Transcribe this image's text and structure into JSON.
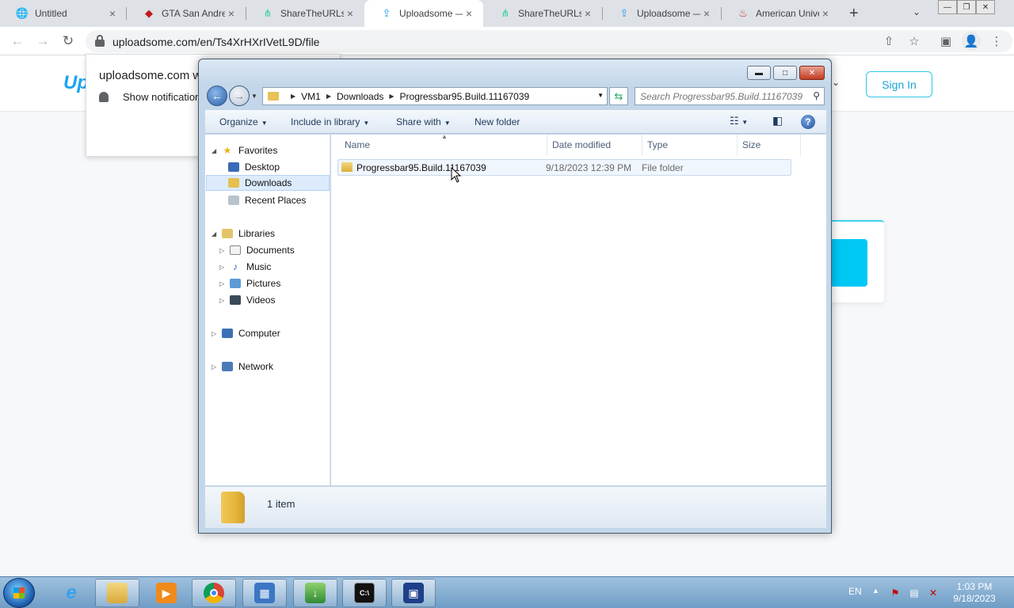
{
  "browser": {
    "tabs": [
      {
        "title": "Untitled",
        "icon": "globe-icon"
      },
      {
        "title": "GTA San Andrea",
        "icon": "gamepad-icon"
      },
      {
        "title": "ShareTheURLs",
        "icon": "share-icon"
      },
      {
        "title": "Uploadsome —",
        "icon": "upload-icon",
        "active": true
      },
      {
        "title": "ShareTheURLs",
        "icon": "share-icon"
      },
      {
        "title": "Uploadsome —",
        "icon": "upload-icon"
      },
      {
        "title": "American Unive",
        "icon": "flame-icon"
      }
    ],
    "url": "uploadsome.com/en/Ts4XrHXrIVetL9D/file"
  },
  "site": {
    "logo": "Up",
    "sign_in": "Sign In"
  },
  "notification": {
    "title": "uploadsome.com w",
    "show_label": "Show notifications"
  },
  "explorer": {
    "breadcrumbs": [
      "VM1",
      "Downloads",
      "Progressbar95.Build.11167039"
    ],
    "search_placeholder": "Search Progressbar95.Build.11167039",
    "commands": {
      "organize": "Organize",
      "include": "Include in library",
      "share": "Share with",
      "new_folder": "New folder"
    },
    "nav": {
      "favorites": "Favorites",
      "desktop": "Desktop",
      "downloads": "Downloads",
      "recent": "Recent Places",
      "libraries": "Libraries",
      "documents": "Documents",
      "music": "Music",
      "pictures": "Pictures",
      "videos": "Videos",
      "computer": "Computer",
      "network": "Network"
    },
    "columns": {
      "name": "Name",
      "date": "Date modified",
      "type": "Type",
      "size": "Size"
    },
    "files": [
      {
        "name": "Progressbar95.Build.11167039",
        "date": "9/18/2023 12:39 PM",
        "type": "File folder",
        "size": ""
      }
    ],
    "item_count": "1 item"
  },
  "taskbar": {
    "lang": "EN",
    "time": "1:03 PM",
    "date": "9/18/2023"
  },
  "colors": {
    "accent_cyan": "#00c8f5",
    "explorer_frame": "#c4d7ea",
    "taskbar": "#6f9dc6"
  }
}
